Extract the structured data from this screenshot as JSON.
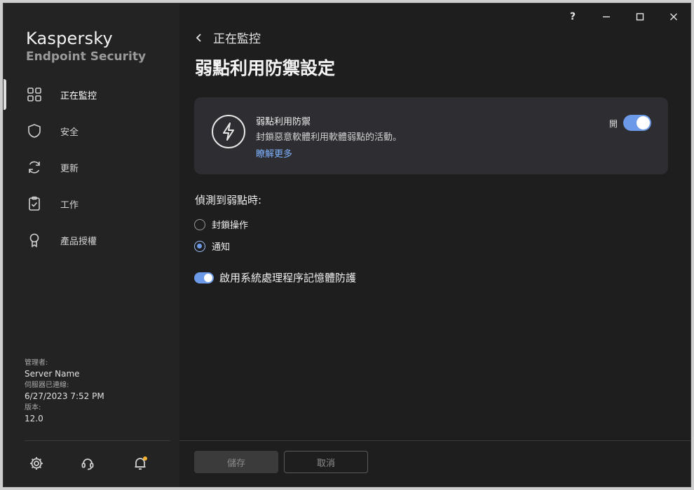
{
  "app": {
    "name": "Kaspersky",
    "product": "Endpoint Security"
  },
  "window_controls": {
    "help": "?",
    "minimize": "minimize-icon",
    "maximize": "maximize-icon",
    "close": "close-icon"
  },
  "sidebar": {
    "items": [
      {
        "label": "正在監控",
        "icon": "grid-icon",
        "active": true
      },
      {
        "label": "安全",
        "icon": "shield-icon",
        "active": false
      },
      {
        "label": "更新",
        "icon": "refresh-icon",
        "active": false
      },
      {
        "label": "工作",
        "icon": "clipboard-icon",
        "active": false
      },
      {
        "label": "產品授權",
        "icon": "award-icon",
        "active": false
      }
    ],
    "info": {
      "admin_label": "管理者:",
      "admin_value": "Server Name",
      "server_label": "伺服器已連線:",
      "server_value": "6/27/2023 7:52 PM",
      "version_label": "版本:",
      "version_value": "12.0"
    },
    "footer_icons": [
      "gear-icon",
      "support-icon",
      "bell-icon"
    ]
  },
  "main": {
    "back_label": "正在監控",
    "title": "弱點利用防禦設定",
    "card": {
      "title": "弱點利用防禦",
      "description": "封鎖惡意軟體利用軟體弱點的活動。",
      "link": "瞭解更多",
      "toggle_label": "開",
      "toggle_on": true
    },
    "section_title": "偵測到弱點時:",
    "options": [
      {
        "label": "封鎖操作",
        "selected": false
      },
      {
        "label": "通知",
        "selected": true
      }
    ],
    "memory_protection": {
      "label": "啟用系統處理程序記憶體防護",
      "on": true
    },
    "buttons": {
      "save": "儲存",
      "cancel": "取消"
    }
  },
  "colors": {
    "accent": "#6d9ae8",
    "link": "#7fb2ff",
    "background": "#1e1e1e",
    "card": "#2e2e32"
  }
}
